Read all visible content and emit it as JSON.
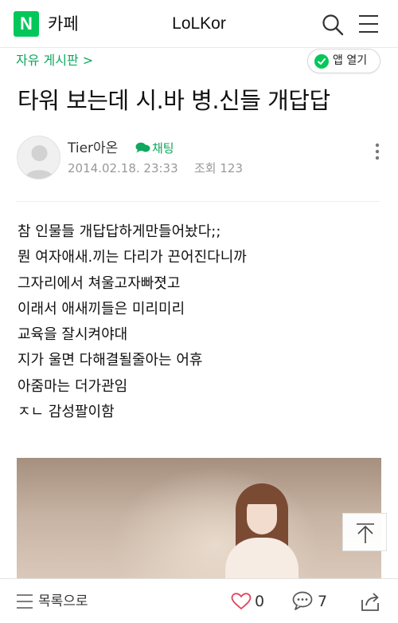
{
  "header": {
    "logo_letter": "N",
    "cafe_label": "카페",
    "site_title": "LoLKor",
    "search_icon": "search-icon",
    "menu_icon": "menu-icon"
  },
  "board": {
    "name": "자유 게시판 >",
    "app_open_label": "앱 열기"
  },
  "post": {
    "title": "타워 보는데 시.바 병.신들 개답답",
    "author": "Tier아온",
    "chat_label": "채팅",
    "date": "2014.02.18. 23:33",
    "views": "조회 123",
    "body_lines": [
      "참 인물들 개답답하게만들어놨다;;",
      "뭔 여자애새.끼는 다리가 끈어진다니까",
      "그자리에서 쳐울고자빠졋고",
      "이래서 애새끼들은 미리미리",
      "교육을 잘시켜야대",
      "지가 울면 다해결될줄아는 어휴",
      "아줌마는 더가관임",
      "ㅈㄴ 감성팔이함"
    ]
  },
  "bottom_bar": {
    "list_label": "목록으로",
    "like_count": "0",
    "comment_count": "7"
  },
  "colors": {
    "brand_green": "#03c75a",
    "link_green": "#0fa85e",
    "like_heart": "#e0465d"
  }
}
